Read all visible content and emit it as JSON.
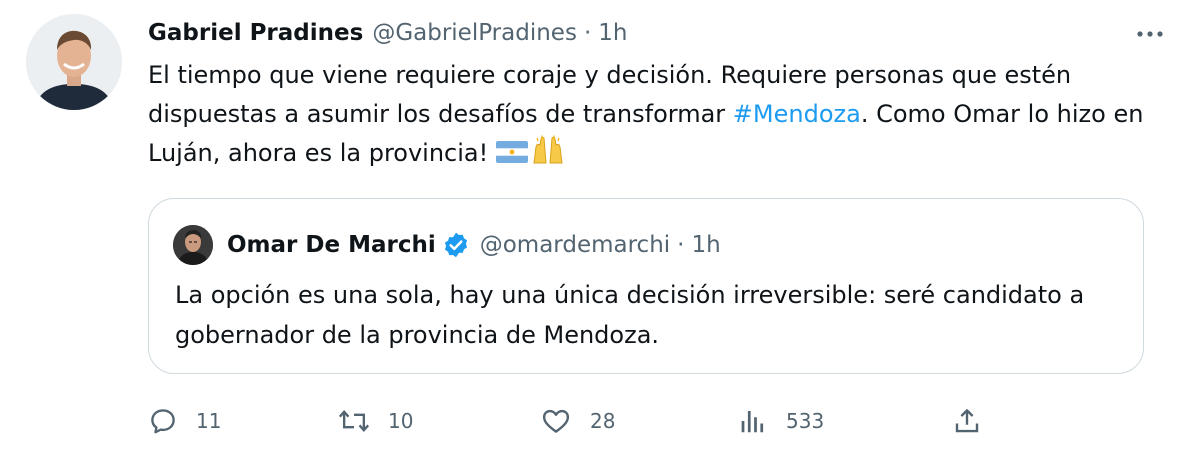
{
  "tweet": {
    "author_name": "Gabriel Pradines",
    "author_handle": "@GabrielPradines",
    "separator": "·",
    "time": "1h",
    "text_part1": "El tiempo que viene requiere coraje y decisión. Requiere personas que estén dispuestas a asumir los desafíos de transformar ",
    "hashtag": "#Mendoza",
    "text_part2": ". Como Omar lo hizo en Luján, ahora es la provincia!"
  },
  "quoted_tweet": {
    "author_name": "Omar De Marchi",
    "author_handle": "@omardemarchi",
    "separator": "·",
    "time": "1h",
    "text": "La opción es una sola, hay una única decisión irreversible: seré candidato a gobernador de la provincia de Mendoza.",
    "verified": true
  },
  "actions": {
    "replies": "11",
    "retweets": "10",
    "likes": "28",
    "views": "533"
  },
  "icons": [
    "more-icon",
    "flag-argentina-emoji",
    "raising-hands-emoji",
    "verified-badge-icon",
    "reply-icon",
    "retweet-icon",
    "like-icon",
    "views-icon",
    "share-icon"
  ],
  "colors": {
    "text": "#0f1419",
    "secondary": "#536471",
    "link": "#1d9bf0",
    "border": "#cfd9de"
  }
}
